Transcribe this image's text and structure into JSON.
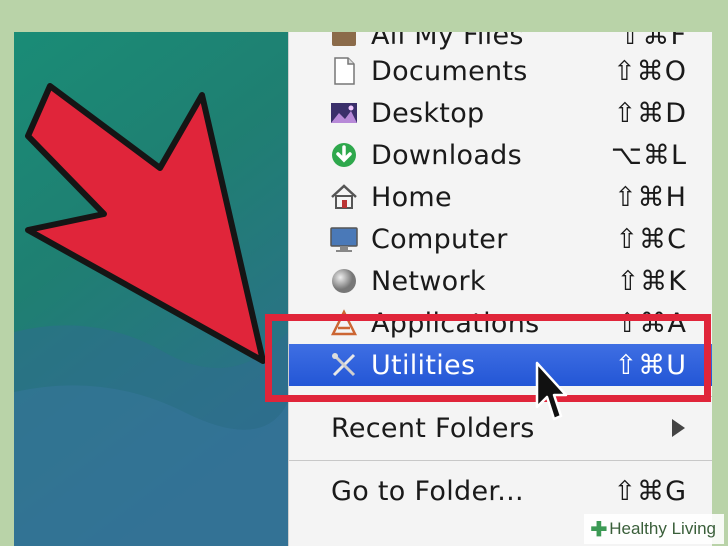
{
  "menu": {
    "items": [
      {
        "label": "All My Files",
        "shortcut": "⇧⌘F",
        "icon": "all-files-icon"
      },
      {
        "label": "Documents",
        "shortcut": "⇧⌘O",
        "icon": "document-icon"
      },
      {
        "label": "Desktop",
        "shortcut": "⇧⌘D",
        "icon": "desktop-icon"
      },
      {
        "label": "Downloads",
        "shortcut": "⌥⌘L",
        "icon": "downloads-icon"
      },
      {
        "label": "Home",
        "shortcut": "⇧⌘H",
        "icon": "home-icon"
      },
      {
        "label": "Computer",
        "shortcut": "⇧⌘C",
        "icon": "computer-icon"
      },
      {
        "label": "Network",
        "shortcut": "⇧⌘K",
        "icon": "network-icon"
      },
      {
        "label": "Applications",
        "shortcut": "⇧⌘A",
        "icon": "applications-icon"
      },
      {
        "label": "Utilities",
        "shortcut": "⇧⌘U",
        "icon": "utilities-icon",
        "selected": true
      }
    ],
    "recent_folders": "Recent Folders",
    "go_to_folder": {
      "label": "Go to Folder...",
      "shortcut": "⇧⌘G"
    }
  },
  "watermark": {
    "text": "Healthy Living"
  },
  "colors": {
    "selection": "#2356d6",
    "highlight": "#e0253a",
    "arrow": "#e0253a"
  }
}
